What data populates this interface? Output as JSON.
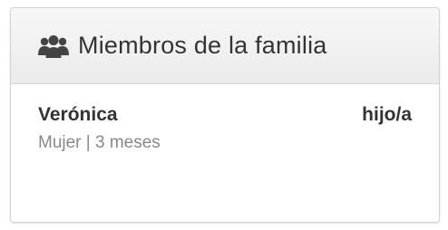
{
  "panel": {
    "title": "Miembros de la familia",
    "icon": "users-icon"
  },
  "members": [
    {
      "name": "Verónica",
      "relation": "hijo/a",
      "details": "Mujer | 3 meses"
    }
  ],
  "colors": {
    "header_bg": "#f0f0f0",
    "text_primary": "#333333",
    "text_secondary": "#888888",
    "border": "#d2d2d2"
  }
}
